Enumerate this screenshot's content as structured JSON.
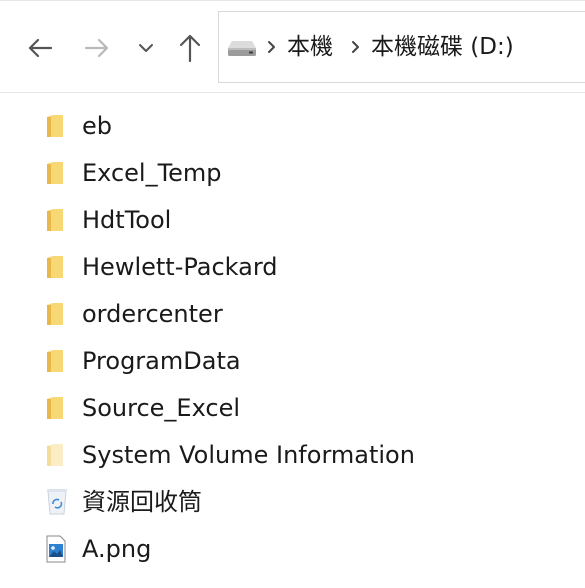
{
  "nav": {
    "back_icon": "arrow-left-icon",
    "forward_icon": "arrow-right-icon",
    "recent_icon": "chevron-down-icon",
    "up_icon": "arrow-up-icon"
  },
  "address": {
    "drive_icon": "drive-icon",
    "separator_icon": "chevron-right-icon",
    "crumbs": [
      "本機",
      "本機磁碟 (D:)"
    ]
  },
  "colors": {
    "folder_yellow": "#f8d775",
    "folder_dark": "#e8b94a",
    "folder_hidden": "#fbeec7",
    "text": "#1a1a1a",
    "nav_disabled": "#b9b9b9",
    "nav_enabled": "#555555"
  },
  "files": [
    {
      "name": "eb",
      "type": "folder"
    },
    {
      "name": "Excel_Temp",
      "type": "folder"
    },
    {
      "name": "HdtTool",
      "type": "folder"
    },
    {
      "name": "Hewlett-Packard",
      "type": "folder"
    },
    {
      "name": "ordercenter",
      "type": "folder"
    },
    {
      "name": "ProgramData",
      "type": "folder"
    },
    {
      "name": "Source_Excel",
      "type": "folder"
    },
    {
      "name": "System Volume Information",
      "type": "folder-hidden"
    },
    {
      "name": "資源回收筒",
      "type": "recycle-bin"
    },
    {
      "name": "A.png",
      "type": "image-file"
    }
  ]
}
